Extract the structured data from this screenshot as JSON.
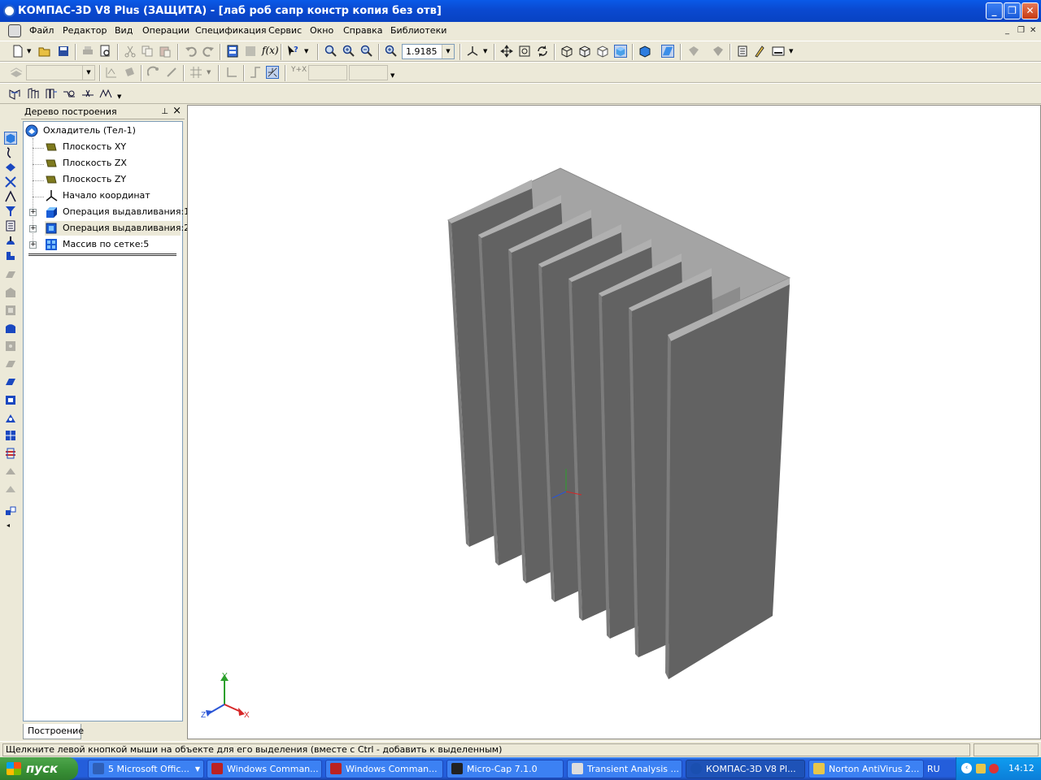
{
  "window": {
    "title": "КОМПАС-3D V8 Plus (ЗАЩИТА) - [лаб роб сапр констр копия без отв]",
    "controls": [
      "minimize-icon",
      "restore-icon",
      "close-icon"
    ]
  },
  "menu": {
    "items": [
      "Файл",
      "Редактор",
      "Вид",
      "Операции",
      "Спецификация",
      "Сервис",
      "Окно",
      "Справка",
      "Библиотеки"
    ]
  },
  "toolbar": {
    "zoom_value": "1.9185"
  },
  "tree": {
    "header": "Дерево построения",
    "root": "Охладитель (Тел-1)",
    "items": [
      {
        "label": "Плоскость XY",
        "icon": "plane-icon",
        "expandable": false
      },
      {
        "label": "Плоскость ZX",
        "icon": "plane-icon",
        "expandable": false
      },
      {
        "label": "Плоскость ZY",
        "icon": "plane-icon",
        "expandable": false
      },
      {
        "label": "Начало координат",
        "icon": "origin-icon",
        "expandable": false
      },
      {
        "label": "Операция выдавливания:1",
        "icon": "extrude-icon",
        "expandable": true
      },
      {
        "label": "Операция выдавливания:2",
        "icon": "extrude-icon",
        "expandable": true
      },
      {
        "label": "Массив по сетке:5",
        "icon": "grid-array-icon",
        "expandable": true
      }
    ],
    "tab": "Построение"
  },
  "viewport": {
    "axes": {
      "y": "Y",
      "z": "Z",
      "x": "X"
    },
    "colors": {
      "fin_front": "#636363",
      "fin_side": "#7b7b7b",
      "top": "#a3a3a3",
      "slot": "#8f8f8f"
    }
  },
  "status": {
    "message": "Щелкните левой кнопкой мыши на объекте для его выделения (вместе с Ctrl - добавить к выделенным)"
  },
  "taskbar": {
    "start": "пуск",
    "tasks": [
      {
        "label": "5 Microsoft Offic...",
        "color": "#2f5fb7"
      },
      {
        "label": "Windows Comman...",
        "color": "#b22"
      },
      {
        "label": "Windows Comman...",
        "color": "#b22"
      },
      {
        "label": "Micro-Cap 7.1.0",
        "color": "#222"
      },
      {
        "label": "Transient Analysis ...",
        "color": "#ddd"
      },
      {
        "label": "КОМПАС-3D V8 Pl...",
        "color": "#1a4fb0"
      },
      {
        "label": "Norton AntiVirus 2...",
        "color": "#e8c64a"
      }
    ],
    "lang": "RU",
    "clock": "14:12"
  }
}
